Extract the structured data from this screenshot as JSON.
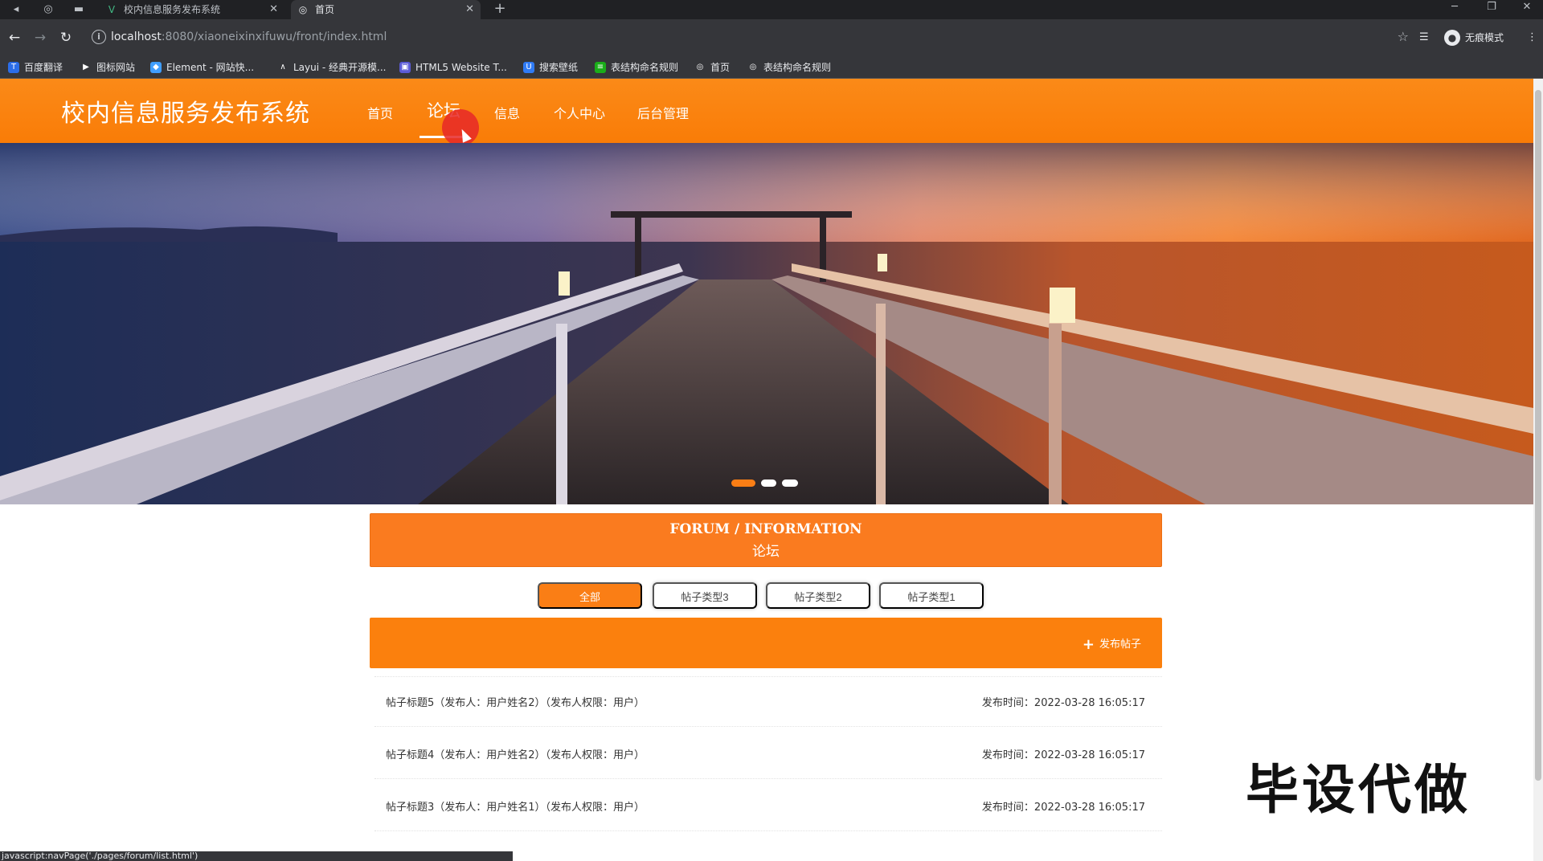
{
  "browser": {
    "tabs": [
      {
        "title": "校内信息服务发布系统",
        "active": false
      },
      {
        "title": "首页",
        "active": true
      }
    ],
    "new_tab_icon": "plus-icon",
    "url_host": "localhost",
    "url_rest": ":8080/xiaoneixinxifuwu/front/index.html",
    "profile_label": "无痕模式",
    "bookmarks": [
      {
        "label": "百度翻译",
        "color": "#2b6de8",
        "icon": "T"
      },
      {
        "label": "图标网站",
        "color": "#35363a",
        "icon": "▶"
      },
      {
        "label": "Element - 网站快...",
        "color": "#409eff",
        "icon": "◆"
      },
      {
        "label": "Layui - 经典开源模...",
        "color": "#35363a",
        "icon": "∧"
      },
      {
        "label": "HTML5 Website T...",
        "color": "#5b5bd6",
        "icon": "▣"
      },
      {
        "label": "搜索壁纸",
        "color": "#2f7bf5",
        "icon": "U"
      },
      {
        "label": "表结构命名规则",
        "color": "#1aad19",
        "icon": "≡"
      },
      {
        "label": "首页",
        "color": "#35363a",
        "icon": "◎"
      },
      {
        "label": "表结构命名规则",
        "color": "#35363a",
        "icon": "◎"
      }
    ],
    "status_text": "javascript:navPage('./pages/forum/list.html')"
  },
  "site": {
    "title": "校内信息服务发布系统",
    "menu": [
      "首页",
      "论坛",
      "信息",
      "个人中心",
      "后台管理"
    ],
    "active_menu": "论坛",
    "accent_color": "#fa7e15"
  },
  "banner": {
    "slides_count": 3,
    "active_slide": 1
  },
  "forum": {
    "heading_en": "FORUM / INFORMATION",
    "heading_cn": "论坛",
    "filters": [
      "全部",
      "帖子类型3",
      "帖子类型2",
      "帖子类型1"
    ],
    "active_filter": "全部",
    "post_button": "发布帖子",
    "posts": [
      {
        "title": "帖子标题5（发布人：用户姓名2）（发布人权限：用户）",
        "time": "发布时间：2022-03-28 16:05:17"
      },
      {
        "title": "帖子标题4（发布人：用户姓名2）（发布人权限：用户）",
        "time": "发布时间：2022-03-28 16:05:17"
      },
      {
        "title": "帖子标题3（发布人：用户姓名1）（发布人权限：用户）",
        "time": "发布时间：2022-03-28 16:05:17"
      }
    ]
  },
  "overlay_text": "毕设代做"
}
